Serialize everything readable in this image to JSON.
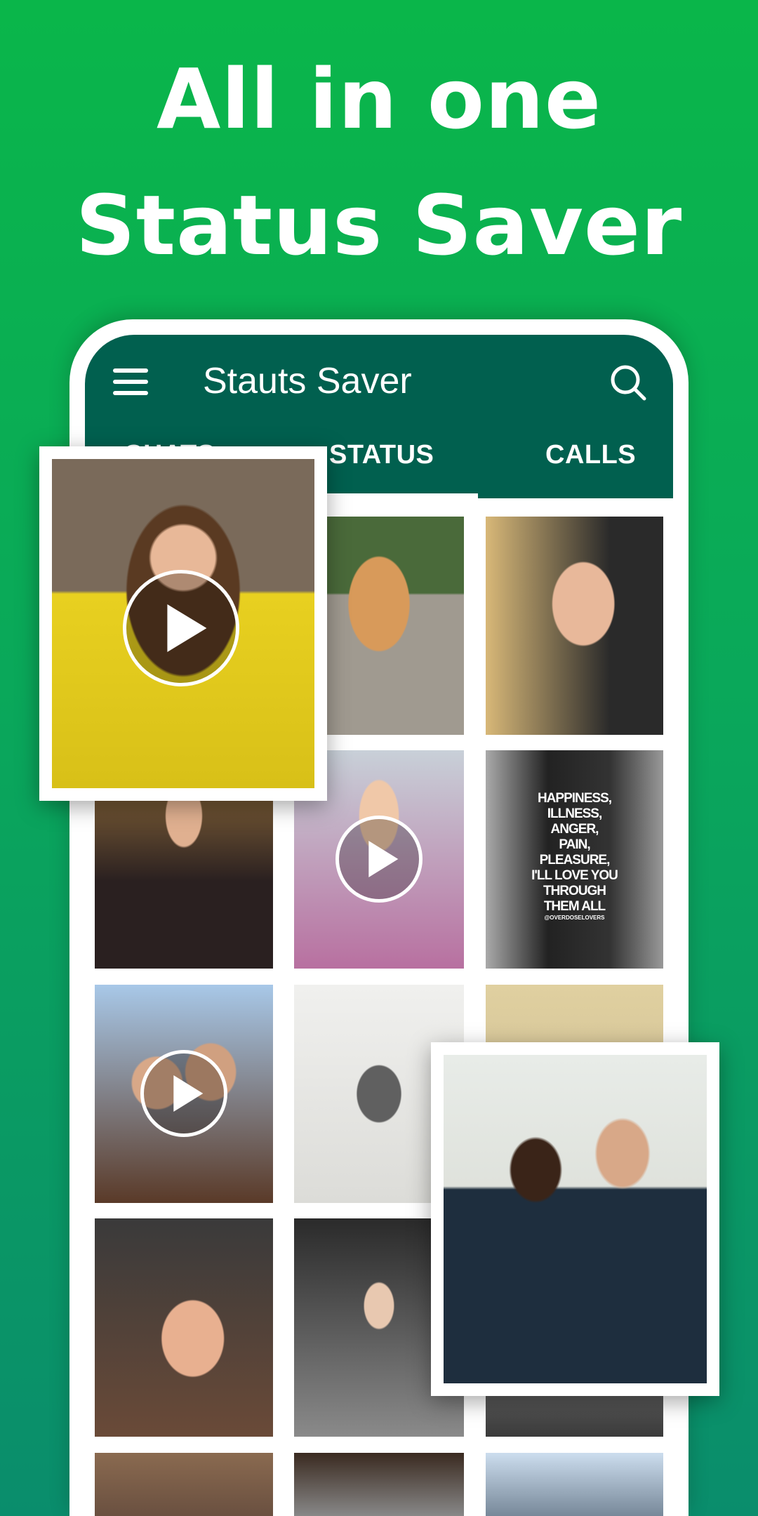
{
  "headline": {
    "line1": "All in one",
    "line2": "Status Saver"
  },
  "app": {
    "title": "Stauts Saver",
    "menu_icon": "hamburger-menu-icon",
    "search_icon": "search-icon"
  },
  "tabs": [
    {
      "label": "CHATS"
    },
    {
      "label": "STATUS",
      "active": true
    },
    {
      "label": "CALLS"
    }
  ],
  "colors": {
    "background_top": "#0ab64a",
    "background_bottom": "#0a8d6c",
    "appbar": "#01604f"
  },
  "quote": {
    "lines": [
      "HAPPINESS,",
      "ILLNESS,",
      "ANGER,",
      "PAIN,",
      "PLEASURE,",
      "I'LL LOVE YOU",
      "THROUGH",
      "THEM ALL"
    ],
    "credit": "@OVERDOSELOVERS"
  },
  "grid": [
    {
      "kind": "photo",
      "video": false
    },
    {
      "kind": "cat",
      "video": false
    },
    {
      "kind": "blonde",
      "video": false
    },
    {
      "kind": "woman-forest",
      "video": false
    },
    {
      "kind": "child",
      "video": true
    },
    {
      "kind": "quote",
      "video": false
    },
    {
      "kind": "selfie-girls",
      "video": true
    },
    {
      "kind": "mirror-man",
      "video": false
    },
    {
      "kind": "cap-man",
      "video": false
    },
    {
      "kind": "couple-car",
      "video": false
    },
    {
      "kind": "mask-woman",
      "video": false
    },
    {
      "kind": "dark",
      "video": false
    },
    {
      "kind": "sunglasses",
      "video": false
    },
    {
      "kind": "curly",
      "video": false
    },
    {
      "kind": "women",
      "video": false
    }
  ],
  "featured": [
    {
      "kind": "sunglasses-yellow",
      "video": true
    },
    {
      "kind": "friends-hug",
      "video": false
    }
  ]
}
